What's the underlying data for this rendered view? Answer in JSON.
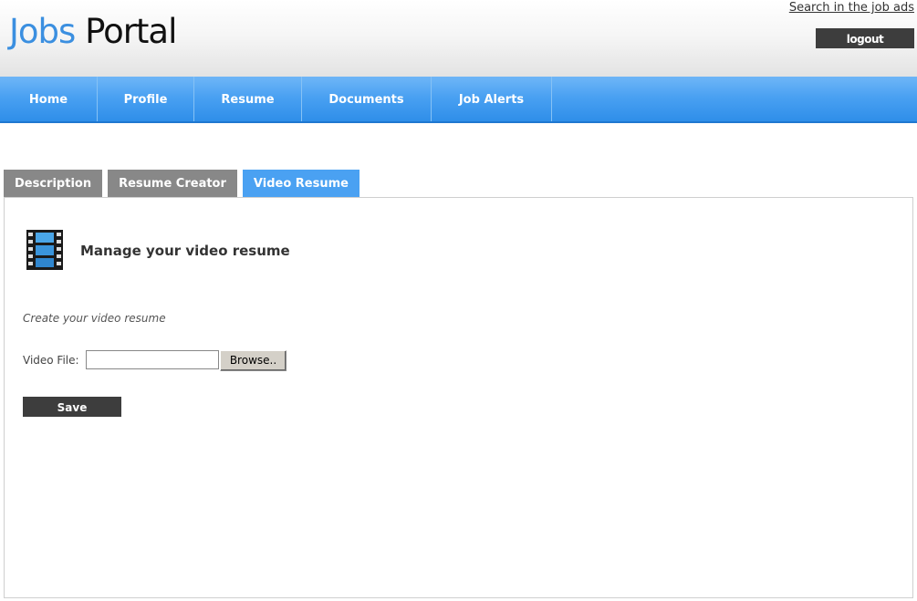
{
  "header": {
    "logo_part1": "Jobs",
    "logo_part2": "Portal",
    "search_link": "Search in the job ads",
    "logout_label": "logout"
  },
  "nav": {
    "items": [
      {
        "label": "Home"
      },
      {
        "label": "Profile"
      },
      {
        "label": "Resume"
      },
      {
        "label": "Documents"
      },
      {
        "label": "Job Alerts"
      }
    ]
  },
  "tabs": [
    {
      "label": "Description",
      "active": false
    },
    {
      "label": "Resume Creator",
      "active": false
    },
    {
      "label": "Video Resume",
      "active": true
    }
  ],
  "panel": {
    "icon": "film-strip-icon",
    "title": "Manage your video resume",
    "help_text": "Create your video resume",
    "file_label": "Video File:",
    "file_value": "",
    "browse_label": "Browse..",
    "save_label": "Save"
  },
  "colors": {
    "accent": "#4aa1f2",
    "logo_blue": "#3b8fe0",
    "dark_button": "#3d3d3d",
    "inactive_tab": "#888888"
  }
}
